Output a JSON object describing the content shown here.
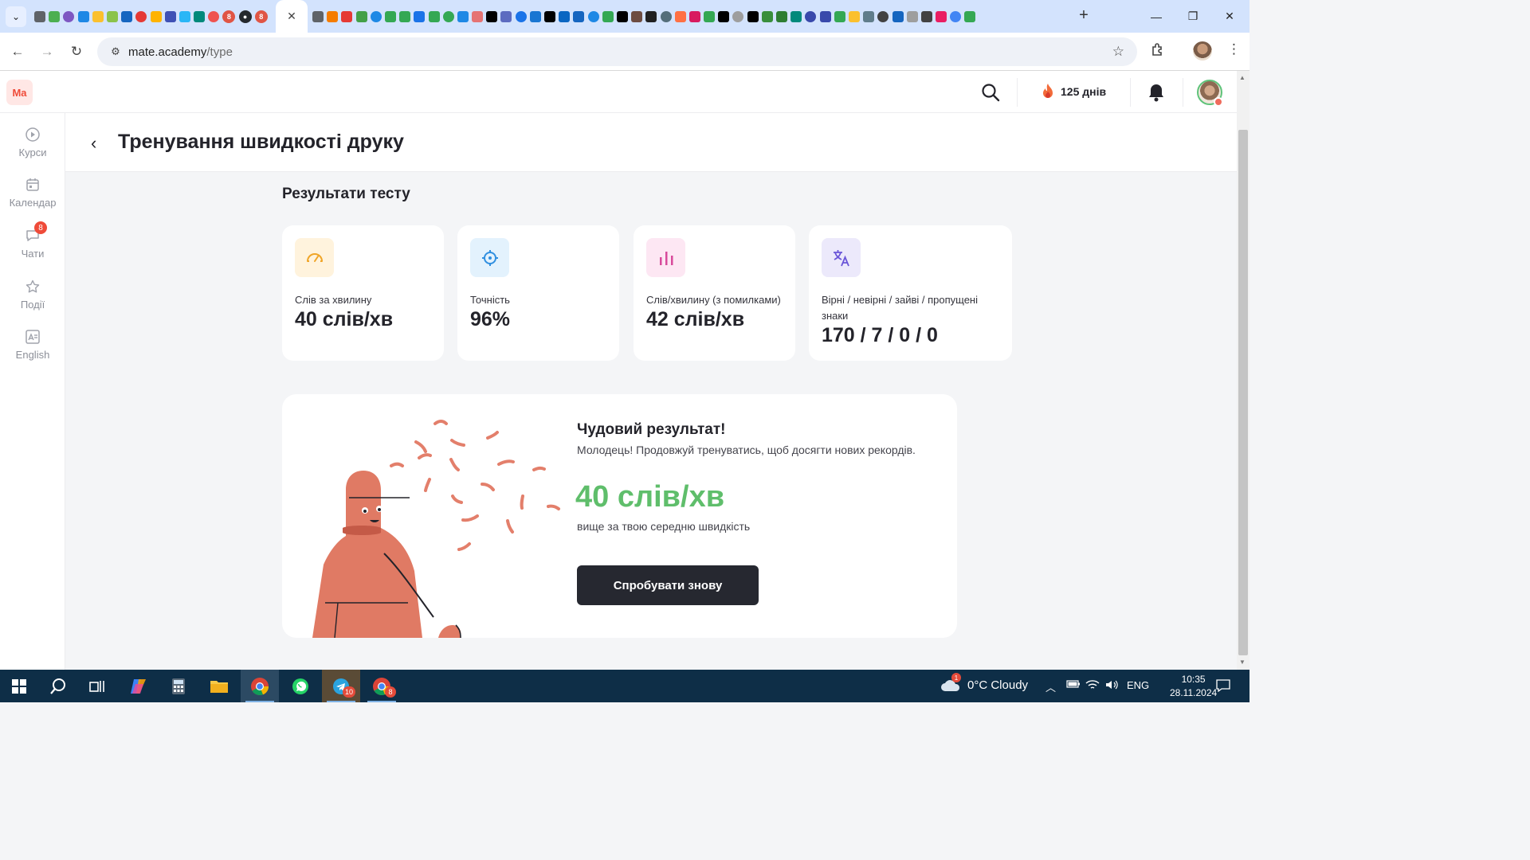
{
  "browser": {
    "url_host": "mate.academy",
    "url_path": "/type",
    "active_tab_close": "✕",
    "tab_badges": [
      "8",
      "8",
      "8"
    ],
    "tab_icon_colors": [
      "#5f6368",
      "#4caf50",
      "#7e57c2",
      "#1e88e5",
      "#fbc02d",
      "#8bc34a",
      "#1565c0",
      "#e53935",
      "#ffb300",
      "#3f51b5",
      "#29b6f6",
      "#00897b",
      "#ef5350",
      "#5f6368",
      "#f57c00",
      "#e53935",
      "#43a047",
      "#1e88e5",
      "#34a853",
      "#34a853",
      "#1a73e8",
      "#34a853",
      "#34a853",
      "#1e88e5",
      "#e57373",
      "#000000",
      "#5c6bc0",
      "#1a73e8",
      "#1976d2",
      "#000000",
      "#0a66c2",
      "#1565c0",
      "#1e88e5",
      "#34a853",
      "#000000",
      "#6d4c41",
      "#212121",
      "#546e7a",
      "#ff7043",
      "#d81b60",
      "#34a853",
      "#000000",
      "#9e9e9e",
      "#000000",
      "#388e3c",
      "#2e7d32",
      "#00897b",
      "#3949ab",
      "#3949ab",
      "#34a853",
      "#fbc02d",
      "#607d8b",
      "#424242",
      "#1565c0",
      "#9e9e9e",
      "#424242",
      "#e91e63",
      "#4285f4",
      "#34a853"
    ]
  },
  "header": {
    "logo": "Ma",
    "streak": "125 днів",
    "accent_color": "#ef4b39"
  },
  "sidebar": {
    "items": [
      {
        "label": "Курси",
        "icon": "play-circle-icon"
      },
      {
        "label": "Календар",
        "icon": "calendar-icon"
      },
      {
        "label": "Чати",
        "icon": "chat-icon",
        "badge": "8"
      },
      {
        "label": "Події",
        "icon": "star-icon"
      },
      {
        "label": "English",
        "icon": "english-icon"
      }
    ]
  },
  "page": {
    "title": "Тренування швидкості друку",
    "results_title": "Результати тесту"
  },
  "cards": [
    {
      "label": "Слів за хвилину",
      "value": "40 слів/хв",
      "icon": "speedometer-icon",
      "icon_bg": "#fff3dd",
      "icon_color": "#f0a528"
    },
    {
      "label": "Точність",
      "value": "96%",
      "icon": "crosshair-icon",
      "icon_bg": "#e3f2fd",
      "icon_color": "#2f8fe0"
    },
    {
      "label": "Слів/хвилину (з помилками)",
      "value": "42 слів/хв",
      "icon": "bar-chart-icon",
      "icon_bg": "#fde7f3",
      "icon_color": "#d84a9b"
    },
    {
      "label": "Вірні / невірні / зайві / пропущені знаки",
      "value": "170 / 7 / 0 / 0",
      "icon": "translate-icon",
      "icon_bg": "#ece9fb",
      "icon_color": "#6a55d8"
    }
  ],
  "result": {
    "title": "Чудовий результат!",
    "subtitle": "Молодець! Продовжуй тренуватись, щоб досягти нових рекордів.",
    "speed": "40 слів/хв",
    "compare": "вище за твою середню швидкість",
    "retry_label": "Спробувати знову",
    "speed_color": "#5fbe6b"
  },
  "taskbar": {
    "weather": "0°C  Cloudy",
    "weather_badge": "1",
    "language": "ENG",
    "time": "10:35",
    "date": "28.11.2024",
    "telegram_badge": "10",
    "chrome_badge": "8"
  }
}
